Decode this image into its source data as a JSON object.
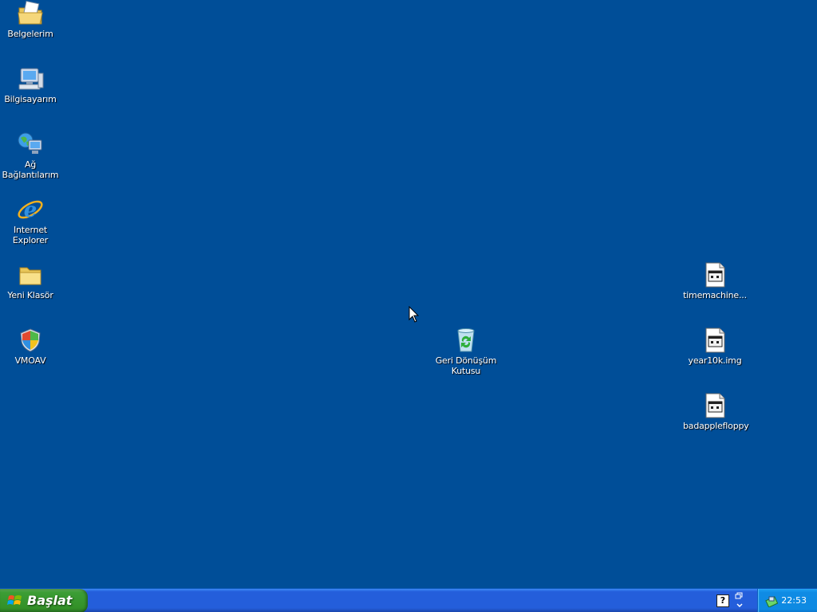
{
  "desktop": {
    "background_color": "#004e98",
    "icons": [
      {
        "label": "Belgelerim",
        "icon": "my-documents-folder-icon"
      },
      {
        "label": "Bilgisayarım",
        "icon": "my-computer-icon"
      },
      {
        "label": "Ağ Bağlantılarım",
        "icon": "network-places-icon"
      },
      {
        "label": "Internet Explorer",
        "icon": "internet-explorer-icon"
      },
      {
        "label": "Yeni Klasör",
        "icon": "folder-icon"
      },
      {
        "label": "VMOAV",
        "icon": "security-shield-icon"
      },
      {
        "label": "Geri Dönüşüm Kutusu",
        "icon": "recycle-bin-icon"
      },
      {
        "label": "timemachine...",
        "icon": "disk-image-file-icon"
      },
      {
        "label": "year10k.img",
        "icon": "disk-image-file-icon"
      },
      {
        "label": "badapplefloppy",
        "icon": "disk-image-file-icon"
      }
    ]
  },
  "taskbar": {
    "start_label": "Başlat",
    "help_label": "?",
    "clock": "22:53",
    "colors": {
      "taskbar": "#245edb",
      "start": "#3c9d35",
      "tray": "#0f8be4"
    }
  }
}
